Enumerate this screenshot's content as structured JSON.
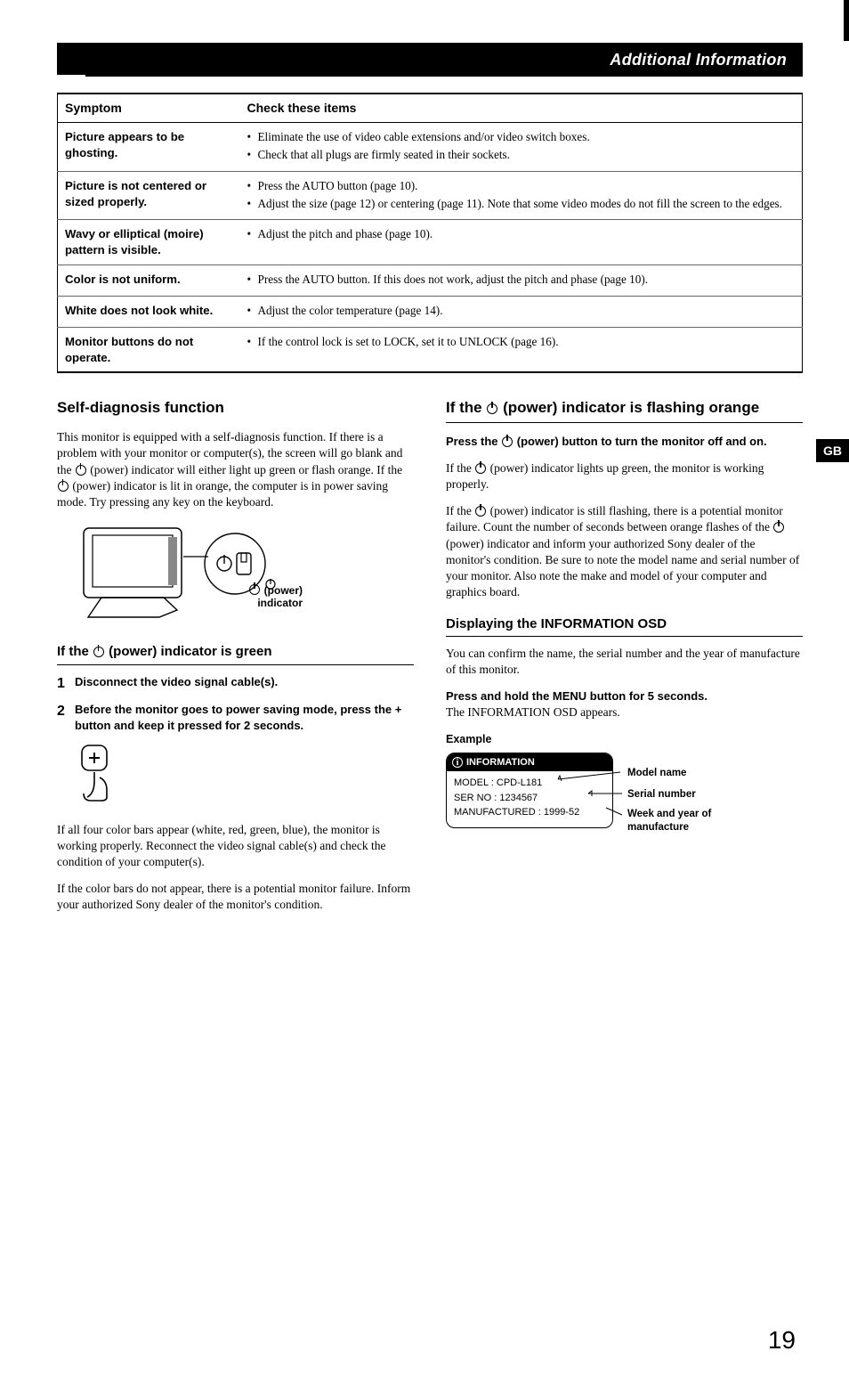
{
  "banner": {
    "title": "Additional Information"
  },
  "gb_tag": "GB",
  "table": {
    "head_symptom": "Symptom",
    "head_check": "Check these items",
    "rows": [
      {
        "symptom": "Picture appears to be ghosting.",
        "checks": [
          "Eliminate the use of video cable extensions and/or video switch boxes.",
          "Check that all plugs are firmly seated in their sockets."
        ]
      },
      {
        "symptom": "Picture is not centered or sized properly.",
        "checks": [
          "Press the AUTO button (page 10).",
          "Adjust the size (page 12) or centering (page 11). Note that some video modes do not fill the screen to the edges."
        ]
      },
      {
        "symptom": "Wavy or elliptical (moire) pattern is visible.",
        "checks": [
          "Adjust the pitch and phase (page 10)."
        ]
      },
      {
        "symptom": "Color is not uniform.",
        "checks": [
          "Press the AUTO button. If this does not work, adjust the pitch and phase (page 10)."
        ]
      },
      {
        "symptom": "White does not look white.",
        "checks": [
          "Adjust the color temperature (page 14)."
        ]
      },
      {
        "symptom": "Monitor buttons do not operate.",
        "checks": [
          "If the control lock is set to LOCK, set it to UNLOCK (page 16)."
        ]
      }
    ]
  },
  "left": {
    "h2": "Self-diagnosis function",
    "p1a": "This monitor is equipped with a self-diagnosis function. If there is a problem with your monitor or computer(s), the screen will go blank and the ",
    "p1b": " (power) indicator will either light up green or flash orange. If the ",
    "p1c": " (power) indicator is lit in orange, the computer is in power saving mode. Try pressing any key on the keyboard.",
    "fig_label1": "(power)",
    "fig_label2": "indicator",
    "h3_green_a": "If the ",
    "h3_green_b": " (power) indicator is green",
    "step1": "Disconnect the video signal cable(s).",
    "step2": "Before the monitor goes to power saving mode, press the + button and keep it pressed for 2 seconds.",
    "p2": "If all four color bars appear (white, red, green, blue), the monitor is working properly. Reconnect the video signal cable(s) and check the condition of your computer(s).",
    "p3": "If the color bars do not appear, there is a potential monitor failure. Inform your authorized Sony dealer of the monitor's condition."
  },
  "right": {
    "h2_a": "If the ",
    "h2_b": " (power) indicator is flashing orange",
    "press_a": "Press the ",
    "press_b": " (power) button to turn the monitor off and on.",
    "p1a": "If the ",
    "p1b": " (power) indicator lights up green, the monitor is working properly.",
    "p2a": "If the ",
    "p2b": " (power) indicator is still flashing, there is a potential monitor failure. Count the number of seconds between orange flashes of the ",
    "p2c": " (power) indicator and inform your authorized Sony dealer of the monitor's condition. Be sure to note the model name and serial number of your monitor. Also note the make and model of your computer and graphics board.",
    "h3_osd": "Displaying the INFORMATION OSD",
    "p_osd1": "You can confirm the name, the serial number and the year of manufacture of this monitor.",
    "p_osd2_bold": "Press and hold the MENU button for 5 seconds.",
    "p_osd2": "The INFORMATION OSD appears.",
    "example": "Example",
    "osd_title": "INFORMATION",
    "osd_model": "MODEL : CPD-L181",
    "osd_serial": "SER  NO : 1234567",
    "osd_mfg": "MANUFACTURED : 1999-52",
    "callout_model": "Model name",
    "callout_serial": "Serial number",
    "callout_week": "Week and year of manufacture"
  },
  "page_number": "19"
}
